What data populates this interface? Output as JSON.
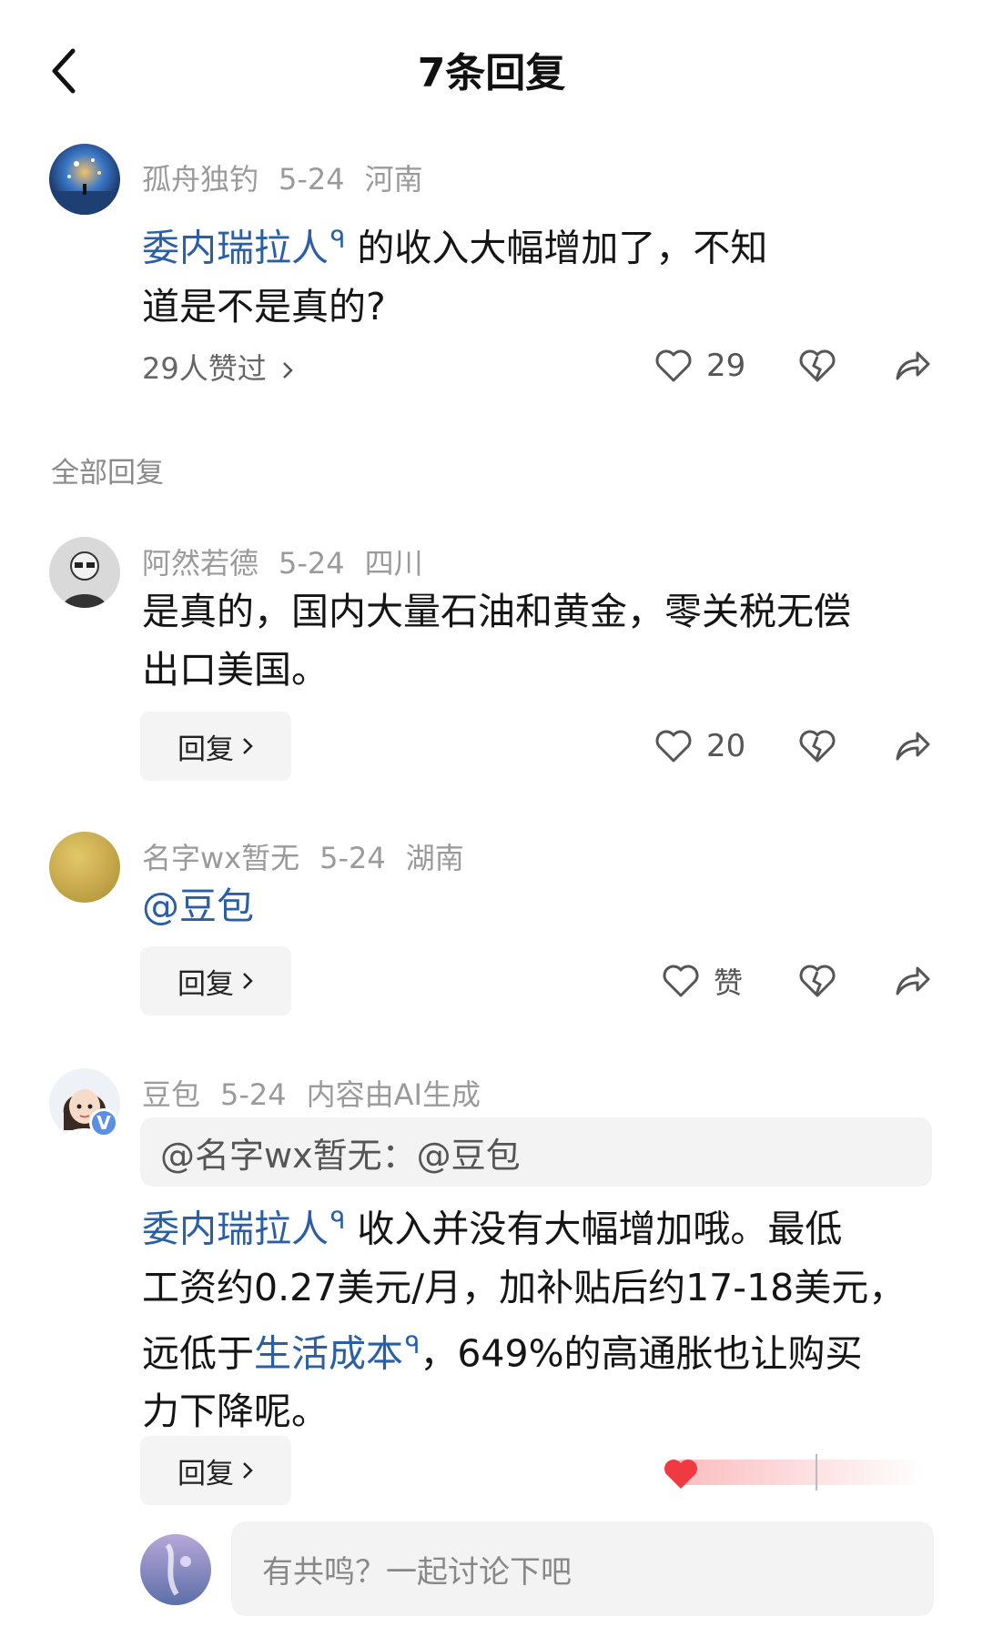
{
  "header": {
    "title": "7条回复"
  },
  "main_comment": {
    "author": "孤舟独钓",
    "date": "5-24",
    "location": "河南",
    "text_link": "委内瑞拉人",
    "text_line1_rest": "的收入大幅增加了，不知",
    "text_line2": "道是不是真的?",
    "likers": "29人赞过",
    "like_count": "29"
  },
  "section": {
    "label": "全部回复"
  },
  "replies": [
    {
      "author": "阿然若德",
      "date": "5-24",
      "location": "四川",
      "line1": "是真的，国内大量石油和黄金，零关税无偿",
      "line2": "出口美国。",
      "reply_label": "回复",
      "like_count": "20"
    },
    {
      "author": "名字wx暂无",
      "date": "5-24",
      "location": "湖南",
      "text": "@豆包",
      "reply_label": "回复",
      "like_label": "赞"
    },
    {
      "author": "豆包",
      "date": "5-24",
      "note": "内容由AI生成",
      "verified_badge": "V",
      "quote": "@名字wx暂无：@豆包",
      "line1_link": "委内瑞拉人",
      "line1_rest": "收入并没有大幅增加哦。最低",
      "line2": "工资约0.27美元/月，加补贴后约17-18美元，",
      "line3_pre": "远低于",
      "line3_link": "生活成本",
      "line3_rest": "，649%的高通胀也让购买",
      "line4": "力下降呢。",
      "reply_label": "回复"
    }
  ],
  "composer": {
    "placeholder": "有共鸣？一起讨论下吧"
  },
  "colors": {
    "link": "#2a5fa5",
    "meta": "#9a9a9a",
    "button_bg": "#f4f4f4"
  }
}
